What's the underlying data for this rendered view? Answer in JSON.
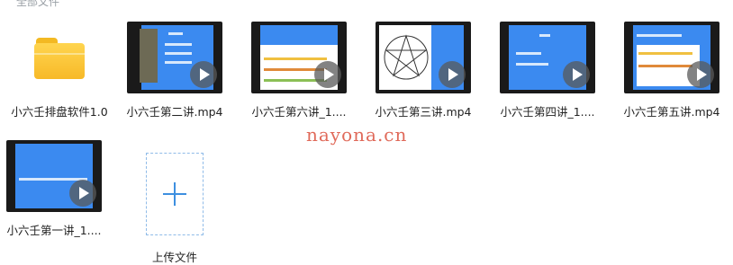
{
  "breadcrumb": {
    "text": "全部文件"
  },
  "files": [
    {
      "name": "小六壬排盘软件1.0",
      "type": "folder"
    },
    {
      "name": "小六壬第二讲.mp4",
      "type": "video"
    },
    {
      "name": "小六壬第六讲_1....",
      "type": "video"
    },
    {
      "name": "小六壬第三讲.mp4",
      "type": "video"
    },
    {
      "name": "小六壬第四讲_1....",
      "type": "video"
    },
    {
      "name": "小六壬第五讲.mp4",
      "type": "video"
    },
    {
      "name": "小六壬第一讲_1....",
      "type": "video"
    }
  ],
  "upload": {
    "label": "上传文件"
  },
  "watermark": {
    "text": "nayona.cn"
  },
  "colors": {
    "slide_blue": "#3b8af0",
    "folder_yellow": "#f7b928",
    "upload_blue": "#3d8fe0"
  }
}
